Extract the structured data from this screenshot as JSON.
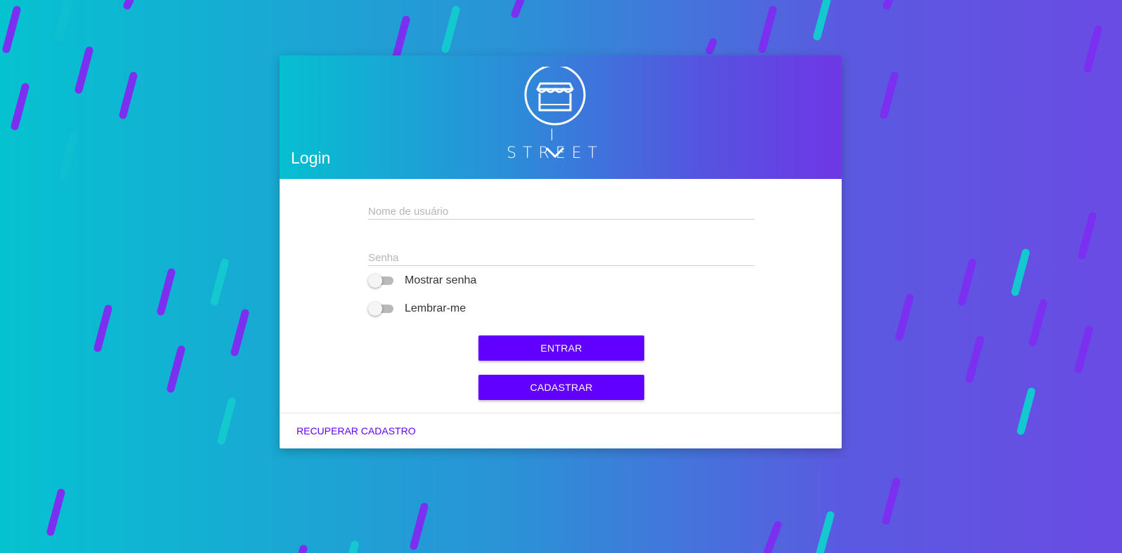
{
  "login": {
    "title": "Login",
    "brand": "I STREET",
    "username_placeholder": "Nome de usuário",
    "password_placeholder": "Senha",
    "show_password_label": "Mostrar senha",
    "remember_me_label": "Lembrar-me",
    "enter_button": "ENTRAR",
    "register_button": "CADASTRAR",
    "recover_link": "RECUPERAR CADASTRO"
  },
  "colors": {
    "accent": "#6200ff",
    "gradient_start": "#05c2d0",
    "gradient_end": "#6a4be4",
    "stripe_purple": "#7b2ff0",
    "stripe_cyan": "#13c9cf"
  },
  "icons": {
    "logo": "storefront-pin-icon"
  }
}
